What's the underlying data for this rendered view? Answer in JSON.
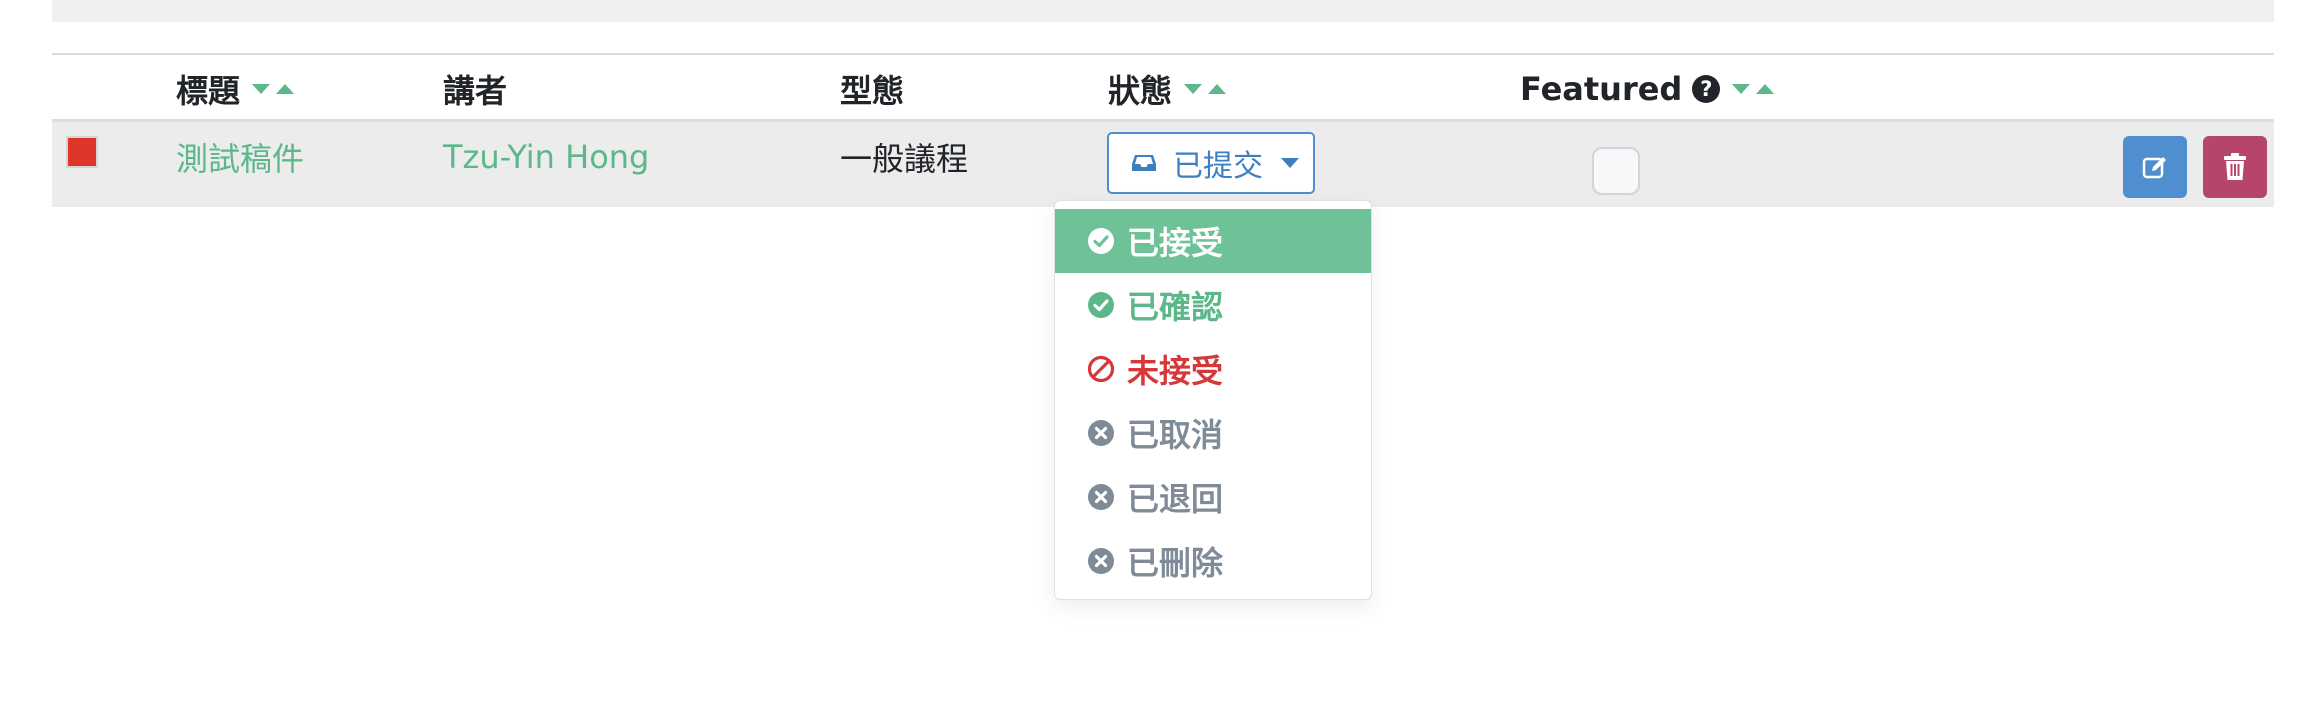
{
  "table": {
    "columns": {
      "title": "標題",
      "speaker": "講者",
      "type": "型態",
      "status": "狀態",
      "featured": "Featured"
    },
    "row": {
      "swatch_color": "#e0352b",
      "title": "測試稿件",
      "speaker": "Tzu-Yin Hong",
      "type": "一般議程",
      "status": "已提交",
      "featured": false
    }
  },
  "status_menu": {
    "items": [
      {
        "label": "已接受",
        "icon": "check-circle-icon",
        "color": "#ffffff",
        "active": true
      },
      {
        "label": "已確認",
        "icon": "check-circle-icon",
        "color": "#5cb88a",
        "active": false
      },
      {
        "label": "未接受",
        "icon": "ban-icon",
        "color": "#d6383a",
        "active": false
      },
      {
        "label": "已取消",
        "icon": "x-circle-icon",
        "color": "#7f8b97",
        "active": false
      },
      {
        "label": "已退回",
        "icon": "x-circle-icon",
        "color": "#7f8b97",
        "active": false
      },
      {
        "label": "已刪除",
        "icon": "x-circle-icon",
        "color": "#7f8b97",
        "active": false
      }
    ]
  },
  "colors": {
    "accent_green": "#5cb88a",
    "primary_blue": "#4f8fcf",
    "danger_red": "#b5466a"
  }
}
